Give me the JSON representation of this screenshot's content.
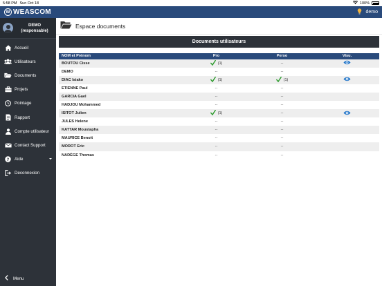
{
  "status_bar": {
    "time": "5:58 PM",
    "date": "Sun Oct 18",
    "battery": "100%"
  },
  "header": {
    "app_name": "WEASCOM",
    "logo_letter": "W",
    "user": "demo"
  },
  "sidebar": {
    "profile": {
      "name": "DEMO",
      "role": "(responsable)"
    },
    "items": [
      {
        "label": "Accueil",
        "icon": "home-icon"
      },
      {
        "label": "Utilisateurs",
        "icon": "users-icon"
      },
      {
        "label": "Documents",
        "icon": "folder-icon"
      },
      {
        "label": "Projets",
        "icon": "briefcase-icon"
      },
      {
        "label": "Pointage",
        "icon": "clock-icon"
      },
      {
        "label": "Rapport",
        "icon": "report-icon"
      },
      {
        "label": "Compte utilisateur",
        "icon": "user-icon"
      },
      {
        "label": "Contact Support",
        "icon": "envelope-icon"
      },
      {
        "label": "Aide",
        "icon": "help-icon"
      },
      {
        "label": "Deconnexion",
        "icon": "logout-icon"
      }
    ],
    "menu_label": "Menu"
  },
  "main": {
    "title": "Espace documents",
    "panel_title": "Documents utilisateurs",
    "columns": [
      "NOM et Prénom",
      "Pro",
      "Perso",
      "Visu."
    ],
    "rows": [
      {
        "name": "BOUTOU Cisse",
        "pro": "(1)",
        "perso": "--",
        "visu": true
      },
      {
        "name": "DEMO",
        "pro": "--",
        "perso": "--",
        "visu": false
      },
      {
        "name": "DIAC Isiako",
        "pro": "(1)",
        "perso": "(1)",
        "visu": true
      },
      {
        "name": "ETIENNE Paul",
        "pro": "--",
        "perso": "--",
        "visu": false
      },
      {
        "name": "GARCIA Gael",
        "pro": "--",
        "perso": "--",
        "visu": false
      },
      {
        "name": "HADJOU Mohammed",
        "pro": "--",
        "perso": "--",
        "visu": false
      },
      {
        "name": "ISITOT Julien",
        "pro": "(1)",
        "perso": "--",
        "visu": true
      },
      {
        "name": "JULES Helene",
        "pro": "--",
        "perso": "--",
        "visu": false
      },
      {
        "name": "KATTAR Moustapha",
        "pro": "--",
        "perso": "--",
        "visu": false
      },
      {
        "name": "MAURICE Benoit",
        "pro": "--",
        "perso": "--",
        "visu": false
      },
      {
        "name": "MOROT Eric",
        "pro": "--",
        "perso": "--",
        "visu": false
      },
      {
        "name": "NADÈGE Thomas",
        "pro": "--",
        "perso": "--",
        "visu": false
      }
    ]
  },
  "colors": {
    "header_blue": "#294a7b",
    "sidebar": "#2d3239",
    "check_green": "#2e9b2e",
    "eye_blue": "#1e73c8",
    "bulb": "#f2b33d"
  }
}
